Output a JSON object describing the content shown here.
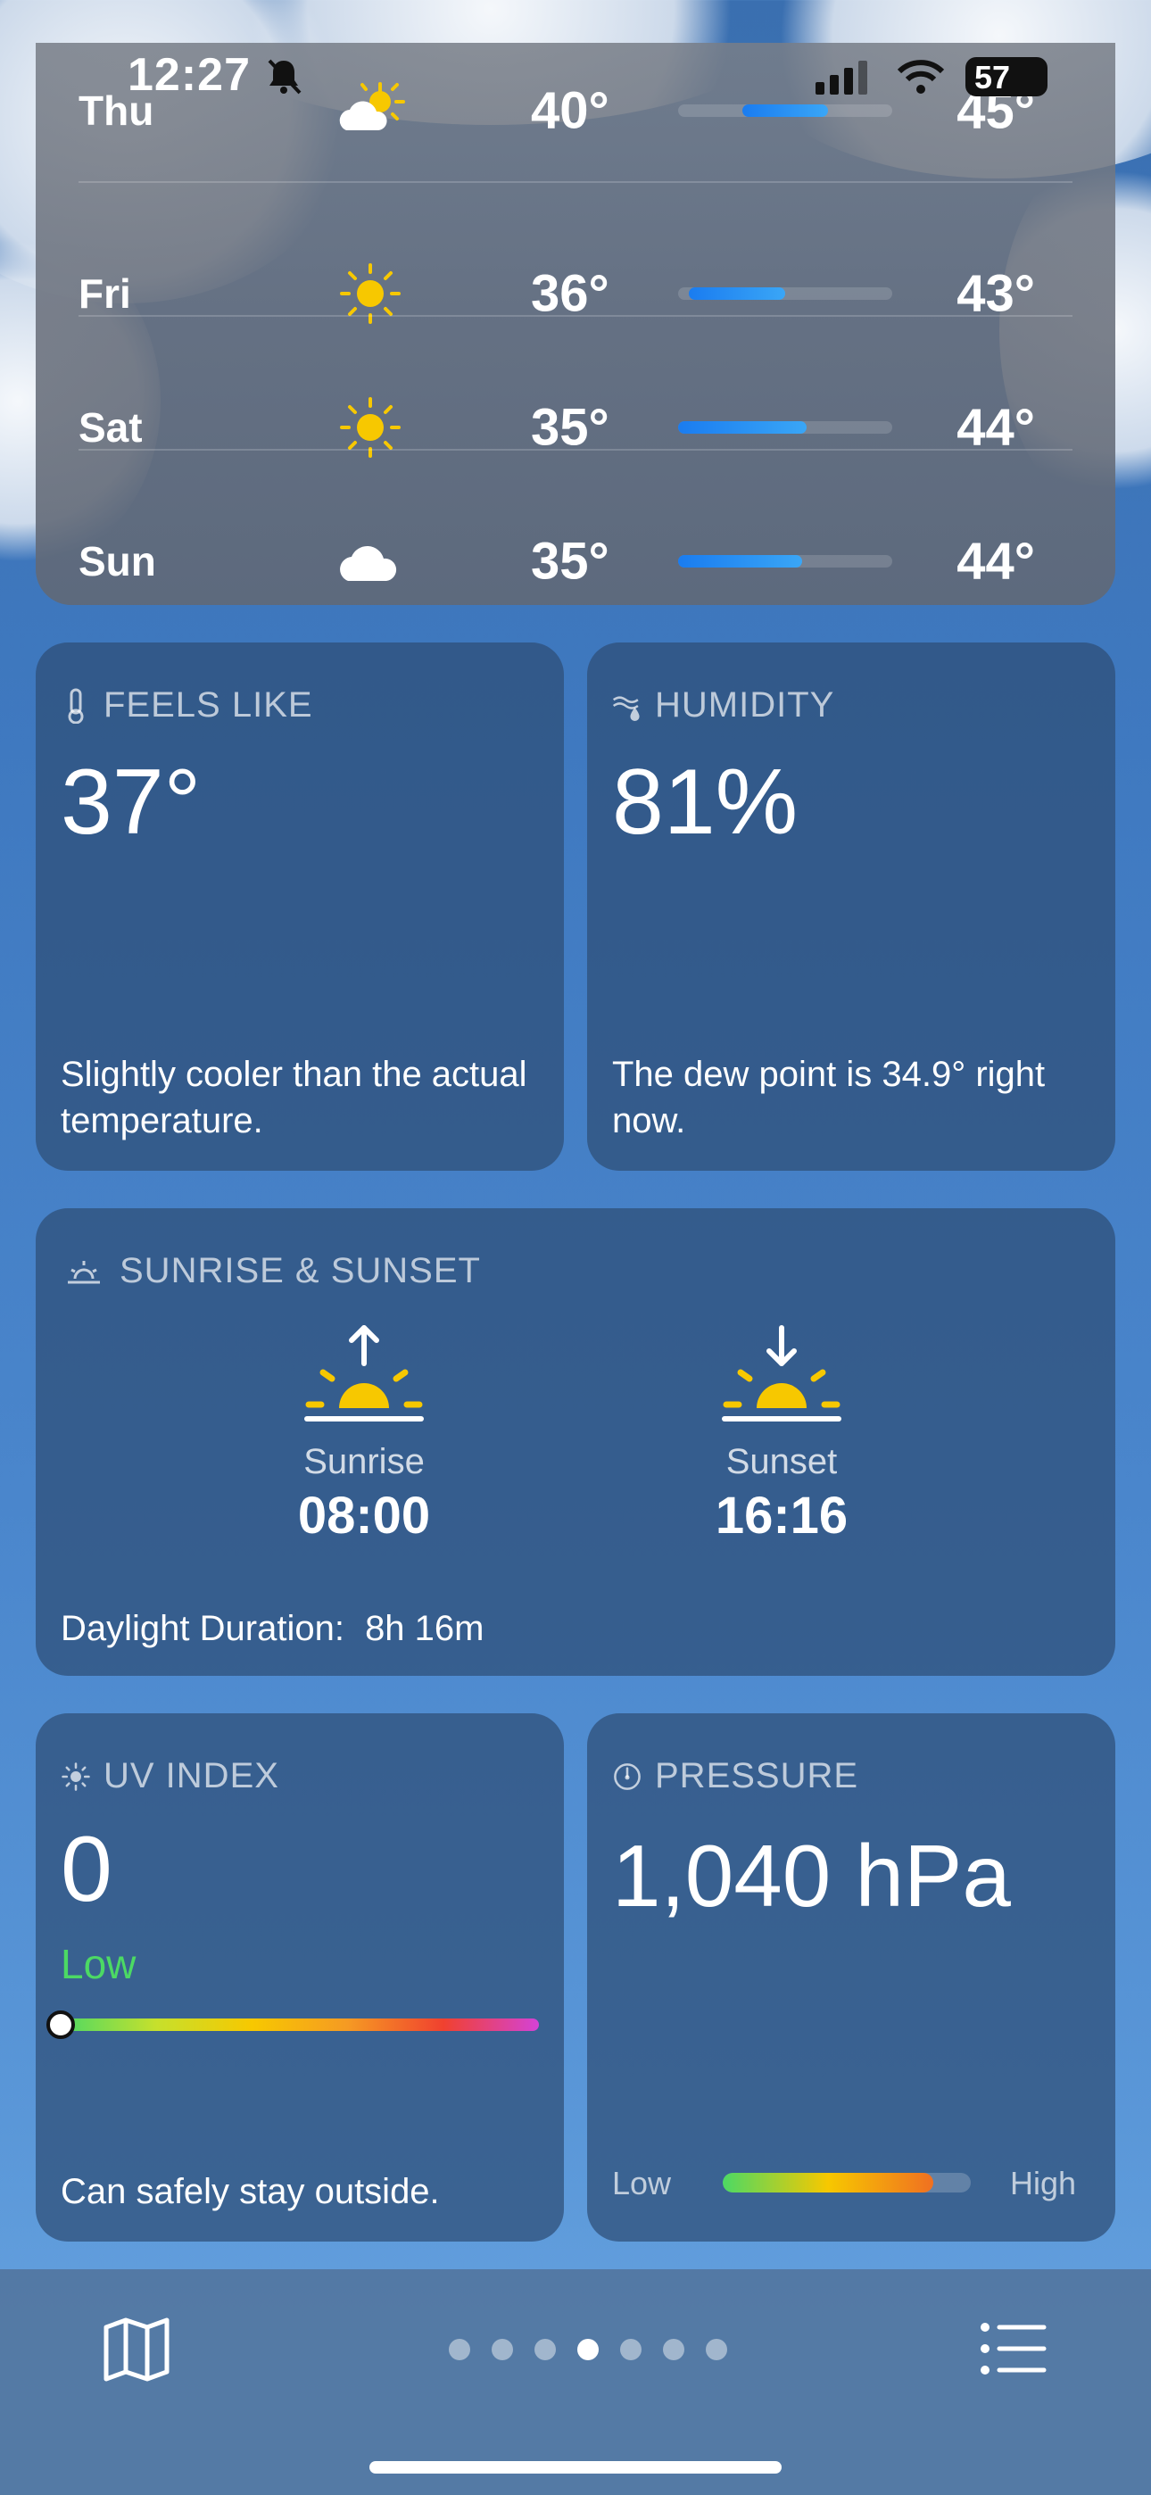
{
  "status_bar": {
    "time": "12:27",
    "battery": "57"
  },
  "forecast": [
    {
      "day": "Thu",
      "icon": "partly-cloudy-icon",
      "low": "40°",
      "high": "45°",
      "range_start": 0.3,
      "range_end": 0.7
    },
    {
      "day": "Fri",
      "icon": "sun-icon",
      "low": "36°",
      "high": "43°",
      "range_start": 0.05,
      "range_end": 0.5
    },
    {
      "day": "Sat",
      "icon": "sun-icon",
      "low": "35°",
      "high": "44°",
      "range_start": 0.0,
      "range_end": 0.6
    },
    {
      "day": "Sun",
      "icon": "cloud-icon",
      "low": "35°",
      "high": "44°",
      "range_start": 0.0,
      "range_end": 0.58
    }
  ],
  "feels_like": {
    "title": "FEELS LIKE",
    "value": "37°",
    "description": "Slightly cooler than the actual temperature."
  },
  "humidity": {
    "title": "HUMIDITY",
    "value": "81%",
    "description": "The dew point is 34.9° right now."
  },
  "sun": {
    "title": "SUNRISE & SUNSET",
    "sunrise_label": "Sunrise",
    "sunrise_time": "08:00",
    "sunset_label": "Sunset",
    "sunset_time": "16:16",
    "daylight_label": "Daylight Duration:",
    "daylight_value": "8h 16m"
  },
  "uv": {
    "title": "UV INDEX",
    "value": "0",
    "level": "Low",
    "description": "Can safely stay outside.",
    "index_fraction": 0.0
  },
  "pressure": {
    "title": "PRESSURE",
    "value": "1,040 hPa",
    "low_label": "Low",
    "high_label": "High",
    "level_fraction": 0.85
  },
  "pages": {
    "count": 7,
    "active": 3
  },
  "colors": {
    "accent_blue": "#1a7cf0",
    "sun_yellow": "#f7c800",
    "uv_low_green": "#4cd964"
  }
}
